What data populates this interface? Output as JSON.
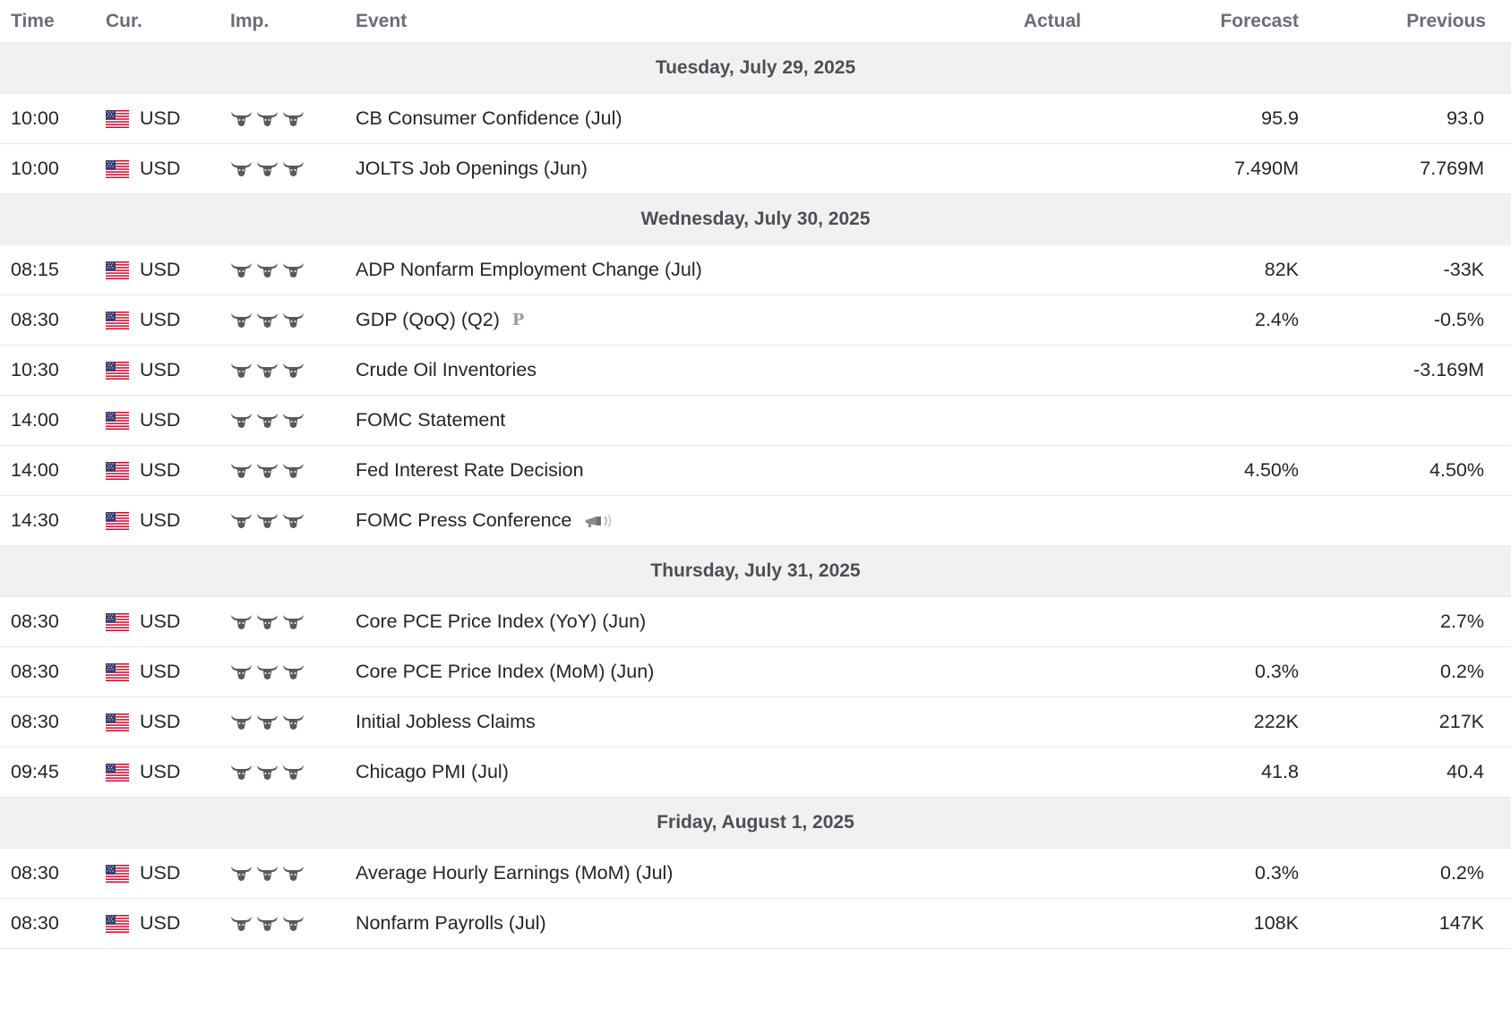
{
  "header": {
    "time": "Time",
    "currency": "Cur.",
    "importance": "Imp.",
    "event": "Event",
    "actual": "Actual",
    "forecast": "Forecast",
    "previous": "Previous"
  },
  "colors": {
    "day_row_bg": "#f1f1f1",
    "bull_icon": "#5a5a5a",
    "divider": "#e6e9eb"
  },
  "days": [
    {
      "date": "Tuesday, July 29, 2025",
      "events": [
        {
          "time": "10:00",
          "currency": "USD",
          "flag": "us-flag-icon",
          "importance": 3,
          "event": "CB Consumer Confidence (Jul)",
          "actual": "",
          "forecast": "95.9",
          "previous": "93.0"
        },
        {
          "time": "10:00",
          "currency": "USD",
          "flag": "us-flag-icon",
          "importance": 3,
          "event": "JOLTS Job Openings (Jun)",
          "actual": "",
          "forecast": "7.490M",
          "previous": "7.769M"
        }
      ]
    },
    {
      "date": "Wednesday, July 30, 2025",
      "events": [
        {
          "time": "08:15",
          "currency": "USD",
          "flag": "us-flag-icon",
          "importance": 3,
          "event": "ADP Nonfarm Employment Change (Jul)",
          "actual": "",
          "forecast": "82K",
          "previous": "-33K"
        },
        {
          "time": "08:30",
          "currency": "USD",
          "flag": "us-flag-icon",
          "importance": 3,
          "event": "GDP (QoQ) (Q2)",
          "badge": "P",
          "actual": "",
          "forecast": "2.4%",
          "previous": "-0.5%"
        },
        {
          "time": "10:30",
          "currency": "USD",
          "flag": "us-flag-icon",
          "importance": 3,
          "event": "Crude Oil Inventories",
          "actual": "",
          "forecast": "",
          "previous": "-3.169M"
        },
        {
          "time": "14:00",
          "currency": "USD",
          "flag": "us-flag-icon",
          "importance": 3,
          "event": "FOMC Statement",
          "actual": "",
          "forecast": "",
          "previous": ""
        },
        {
          "time": "14:00",
          "currency": "USD",
          "flag": "us-flag-icon",
          "importance": 3,
          "event": "Fed Interest Rate Decision",
          "actual": "",
          "forecast": "4.50%",
          "previous": "4.50%"
        },
        {
          "time": "14:30",
          "currency": "USD",
          "flag": "us-flag-icon",
          "importance": 3,
          "event": "FOMC Press Conference",
          "speech_icon": "speaker-icon",
          "actual": "",
          "forecast": "",
          "previous": ""
        }
      ]
    },
    {
      "date": "Thursday, July 31, 2025",
      "events": [
        {
          "time": "08:30",
          "currency": "USD",
          "flag": "us-flag-icon",
          "importance": 3,
          "event": "Core PCE Price Index (YoY) (Jun)",
          "actual": "",
          "forecast": "",
          "previous": "2.7%"
        },
        {
          "time": "08:30",
          "currency": "USD",
          "flag": "us-flag-icon",
          "importance": 3,
          "event": "Core PCE Price Index (MoM) (Jun)",
          "actual": "",
          "forecast": "0.3%",
          "previous": "0.2%"
        },
        {
          "time": "08:30",
          "currency": "USD",
          "flag": "us-flag-icon",
          "importance": 3,
          "event": "Initial Jobless Claims",
          "actual": "",
          "forecast": "222K",
          "previous": "217K"
        },
        {
          "time": "09:45",
          "currency": "USD",
          "flag": "us-flag-icon",
          "importance": 3,
          "event": "Chicago PMI (Jul)",
          "actual": "",
          "forecast": "41.8",
          "previous": "40.4"
        }
      ]
    },
    {
      "date": "Friday, August 1, 2025",
      "events": [
        {
          "time": "08:30",
          "currency": "USD",
          "flag": "us-flag-icon",
          "importance": 3,
          "event": "Average Hourly Earnings (MoM) (Jul)",
          "actual": "",
          "forecast": "0.3%",
          "previous": "0.2%"
        },
        {
          "time": "08:30",
          "currency": "USD",
          "flag": "us-flag-icon",
          "importance": 3,
          "event": "Nonfarm Payrolls (Jul)",
          "actual": "",
          "forecast": "108K",
          "previous": "147K"
        }
      ]
    }
  ]
}
